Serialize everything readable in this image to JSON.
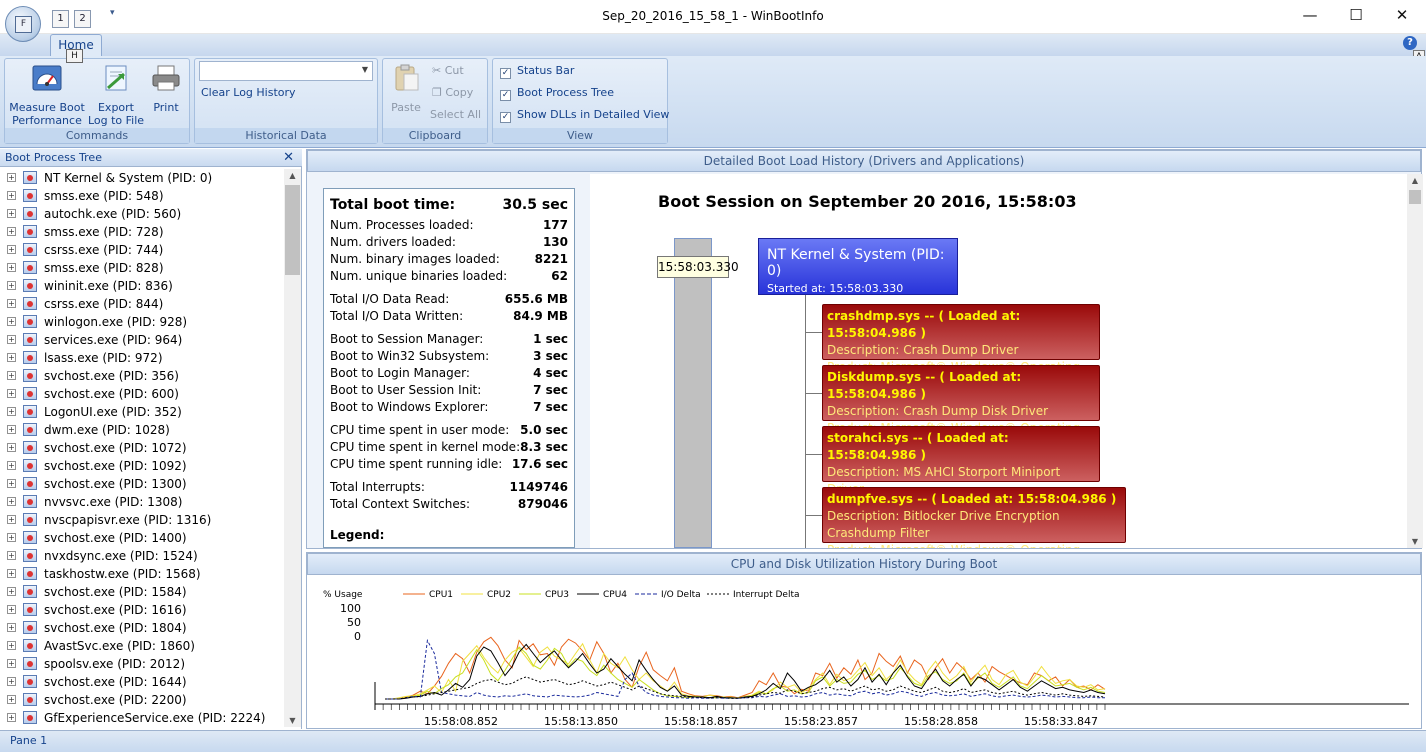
{
  "window": {
    "title": "Sep_20_2016_15_58_1 - WinBootInfo",
    "app_button_tip": "F",
    "qat_tip_1": "1",
    "qat_tip_2": "2",
    "minimize": "—",
    "maximize": "☐",
    "close": "✕"
  },
  "ribbon": {
    "tab_home": "Home",
    "keytip_home": "H",
    "help_icon": "?",
    "keytip_a": "A",
    "commands": {
      "label": "Commands",
      "measure_boot": "Measure Boot Performance",
      "measure_boot_l1": "Measure Boot",
      "measure_boot_l2": "Performance",
      "export_l1": "Export",
      "export_l2": "Log to File",
      "print": "Print"
    },
    "historical": {
      "label": "Historical Data",
      "combo_value": "",
      "clear": "Clear Log History"
    },
    "clipboard": {
      "label": "Clipboard",
      "paste": "Paste",
      "cut": "Cut",
      "copy": "Copy",
      "select_all": "Select All"
    },
    "view": {
      "label": "View",
      "status_bar": "Status Bar",
      "boot_tree": "Boot Process Tree",
      "show_dlls": "Show DLLs in Detailed View"
    }
  },
  "tree_pane": {
    "title": "Boot Process Tree",
    "close": "✕",
    "items": [
      "NT Kernel & System (PID: 0)",
      "smss.exe (PID: 548)",
      "autochk.exe (PID: 560)",
      "smss.exe (PID: 728)",
      "csrss.exe (PID: 744)",
      "smss.exe (PID: 828)",
      "wininit.exe (PID: 836)",
      "csrss.exe (PID: 844)",
      "winlogon.exe (PID: 928)",
      "services.exe (PID: 964)",
      "lsass.exe (PID: 972)",
      "svchost.exe (PID: 356)",
      "svchost.exe (PID: 600)",
      "LogonUI.exe (PID: 352)",
      "dwm.exe (PID: 1028)",
      "svchost.exe (PID: 1072)",
      "svchost.exe (PID: 1092)",
      "svchost.exe (PID: 1300)",
      "nvvsvc.exe (PID: 1308)",
      "nvscpapisvr.exe (PID: 1316)",
      "svchost.exe (PID: 1400)",
      "nvxdsync.exe (PID: 1524)",
      "taskhostw.exe (PID: 1568)",
      "svchost.exe (PID: 1584)",
      "svchost.exe (PID: 1616)",
      "svchost.exe (PID: 1804)",
      "AvastSvc.exe (PID: 1860)",
      "spoolsv.exe (PID: 2012)",
      "svchost.exe (PID: 1644)",
      "svchost.exe (PID: 2200)",
      "GfExperienceService.exe (PID: 2224)"
    ]
  },
  "detail": {
    "header": "Detailed Boot Load History (Drivers and Applications)",
    "stats": {
      "total_label": "Total boot time:",
      "total_value": "30.5 sec",
      "rows1": [
        [
          "Num. Processes loaded:",
          "177"
        ],
        [
          "Num. drivers loaded:",
          "130"
        ],
        [
          "Num. binary images loaded:",
          "8221"
        ],
        [
          "Num. unique binaries loaded:",
          "62"
        ]
      ],
      "rows2": [
        [
          "Total I/O Data Read:",
          "655.6 MB"
        ],
        [
          "Total I/O Data Written:",
          "84.9 MB"
        ]
      ],
      "rows3": [
        [
          "Boot to Session Manager:",
          "1 sec"
        ],
        [
          "Boot to Win32 Subsystem:",
          "3 sec"
        ],
        [
          "Boot to Login Manager:",
          "4 sec"
        ],
        [
          "Boot to User Session Init:",
          "7 sec"
        ],
        [
          "Boot to Windows Explorer:",
          "7 sec"
        ]
      ],
      "rows4": [
        [
          "CPU time spent in user mode:",
          "5.0 sec"
        ],
        [
          "CPU time spent in kernel mode:",
          "8.3 sec"
        ],
        [
          "CPU time spent running idle:",
          "17.6 sec"
        ]
      ],
      "rows5": [
        [
          "Total Interrupts:",
          "1149746"
        ],
        [
          "Total Context Switches:",
          "879046"
        ]
      ],
      "legend": "Legend:"
    },
    "session_title": "Boot Session on September 20 2016, 15:58:03",
    "time_label": "15:58:03.330",
    "nt_title": "NT Kernel & System (PID: 0)",
    "nt_started": "Started at: 15:58:03.330",
    "drivers": [
      {
        "name": "crashdmp.sys -- ( Loaded at: 15:58:04.986 )",
        "desc": "Description: Crash Dump Driver",
        "prod": "Product: Microsoft® Windows® Operating System"
      },
      {
        "name": "Diskdump.sys -- ( Loaded at: 15:58:04.986 )",
        "desc": "Description: Crash Dump Disk Driver",
        "prod": "Product: Microsoft® Windows® Operating System"
      },
      {
        "name": "storahci.sys -- ( Loaded at: 15:58:04.986 )",
        "desc": "Description: MS AHCI Storport Miniport Driver",
        "prod": "Product: Microsoft® Windows® Operating System"
      },
      {
        "name": "dumpfve.sys -- ( Loaded at: 15:58:04.986 )",
        "desc": "Description: Bitlocker Drive Encryption Crashdump Filter",
        "prod": "Product: Microsoft® Windows® Operating System"
      }
    ]
  },
  "cpu_panel": {
    "header": "CPU and Disk Utilization History During Boot"
  },
  "chart_data": {
    "type": "line",
    "ylabel": "% Usage",
    "yticks": [
      "100",
      "50",
      "0"
    ],
    "ylim": [
      0,
      100
    ],
    "xticks": [
      "15:58:08.852",
      "15:58:13.850",
      "15:58:18.857",
      "15:58:23.857",
      "15:58:28.858",
      "15:58:33.847"
    ],
    "legend_position": "top",
    "series": [
      {
        "name": "CPU1",
        "color": "#e8641e",
        "style": "solid",
        "values": [
          0,
          0,
          0,
          3,
          6,
          12,
          8,
          20,
          35,
          55,
          70,
          62,
          40,
          72,
          88,
          95,
          82,
          60,
          48,
          90,
          76,
          85,
          68,
          70,
          52,
          80,
          92,
          86,
          74,
          60,
          88,
          70,
          40,
          55,
          30,
          18,
          50,
          72,
          45,
          36,
          28,
          48,
          12,
          8,
          5,
          4,
          6,
          5,
          3,
          4,
          2,
          6,
          10,
          28,
          22,
          40,
          20,
          18,
          8,
          15,
          12,
          40,
          36,
          55,
          32,
          48,
          38,
          60,
          30,
          40,
          70,
          58,
          50,
          66,
          40,
          60,
          52,
          30,
          48,
          62,
          40,
          56,
          46,
          30,
          40,
          26,
          50,
          42,
          36,
          30,
          25,
          22,
          40,
          36,
          28,
          34,
          20,
          30,
          18,
          20,
          14,
          22,
          15
        ]
      },
      {
        "name": "CPU2",
        "color": "#f0e040",
        "style": "solid",
        "values": [
          0,
          0,
          2,
          4,
          5,
          8,
          14,
          20,
          10,
          30,
          12,
          58,
          70,
          82,
          64,
          50,
          40,
          60,
          72,
          78,
          64,
          50,
          72,
          80,
          66,
          60,
          54,
          70,
          85,
          60,
          40,
          70,
          55,
          48,
          65,
          45,
          30,
          40,
          28,
          20,
          12,
          26,
          8,
          5,
          4,
          3,
          6,
          4,
          2,
          3,
          1,
          4,
          6,
          12,
          8,
          14,
          26,
          18,
          22,
          10,
          16,
          30,
          40,
          22,
          38,
          28,
          32,
          44,
          56,
          36,
          48,
          30,
          40,
          60,
          42,
          30,
          22,
          44,
          58,
          40,
          28,
          36,
          50,
          26,
          40,
          52,
          30,
          22,
          38,
          44,
          26,
          20,
          34,
          50,
          36,
          24,
          28,
          30,
          20,
          18,
          22,
          14,
          16
        ]
      },
      {
        "name": "CPU3",
        "color": "#c8e020",
        "style": "solid",
        "values": [
          0,
          0,
          0,
          2,
          4,
          6,
          12,
          8,
          16,
          22,
          34,
          40,
          58,
          76,
          60,
          38,
          28,
          44,
          62,
          80,
          70,
          52,
          46,
          60,
          78,
          70,
          50,
          62,
          58,
          44,
          36,
          52,
          40,
          30,
          24,
          18,
          30,
          22,
          14,
          8,
          5,
          4,
          3,
          2,
          4,
          3,
          2,
          2,
          3,
          1,
          2,
          3,
          5,
          10,
          8,
          16,
          20,
          12,
          14,
          8,
          10,
          28,
          34,
          20,
          30,
          24,
          26,
          38,
          44,
          30,
          36,
          28,
          32,
          48,
          36,
          24,
          20,
          36,
          42,
          30,
          24,
          28,
          40,
          22,
          32,
          40,
          24,
          18,
          26,
          34,
          20,
          16,
          26,
          36,
          28,
          20,
          22,
          24,
          18,
          14,
          18,
          12,
          10
        ]
      },
      {
        "name": "CPU4",
        "color": "#000000",
        "style": "solid",
        "values": [
          0,
          0,
          0,
          1,
          3,
          4,
          8,
          10,
          6,
          14,
          24,
          18,
          30,
          66,
          80,
          74,
          56,
          36,
          50,
          72,
          84,
          70,
          56,
          66,
          74,
          60,
          48,
          58,
          70,
          54,
          40,
          46,
          62,
          50,
          38,
          28,
          60,
          44,
          30,
          18,
          12,
          20,
          6,
          4,
          3,
          3,
          2,
          4,
          2,
          2,
          1,
          3,
          4,
          8,
          14,
          24,
          16,
          40,
          28,
          12,
          18,
          22,
          30,
          44,
          26,
          34,
          20,
          30,
          48,
          26,
          38,
          22,
          40,
          52,
          34,
          20,
          16,
          32,
          46,
          28,
          20,
          30,
          38,
          20,
          34,
          30,
          22,
          14,
          22,
          30,
          18,
          12,
          20,
          28,
          22,
          16,
          18,
          14,
          12,
          10,
          14,
          10,
          8
        ]
      },
      {
        "name": "I/O Delta",
        "color": "#1a2a9c",
        "style": "dashed",
        "values": [
          0,
          0,
          0,
          2,
          4,
          3,
          90,
          70,
          10,
          8,
          6,
          5,
          4,
          10,
          6,
          4,
          3,
          5,
          4,
          6,
          8,
          5,
          4,
          3,
          6,
          5,
          4,
          3,
          4,
          6,
          10,
          8,
          6,
          4,
          30,
          40,
          20,
          10,
          6,
          4,
          3,
          2,
          2,
          1,
          2,
          1,
          1,
          2,
          1,
          1,
          1,
          2,
          2,
          4,
          3,
          6,
          8,
          4,
          5,
          3,
          4,
          8,
          10,
          6,
          8,
          6,
          5,
          10,
          12,
          8,
          10,
          6,
          8,
          12,
          10,
          6,
          4,
          8,
          10,
          6,
          5,
          6,
          8,
          4,
          6,
          8,
          5,
          3,
          5,
          6,
          4,
          3,
          4,
          6,
          5,
          3,
          4,
          3,
          2,
          2,
          3,
          2,
          2
        ]
      },
      {
        "name": "Interrupt Delta",
        "color": "#000000",
        "style": "dotted",
        "values": [
          0,
          0,
          0,
          2,
          3,
          4,
          6,
          8,
          10,
          12,
          14,
          16,
          18,
          24,
          28,
          30,
          26,
          22,
          24,
          30,
          34,
          30,
          26,
          28,
          30,
          26,
          22,
          24,
          28,
          24,
          20,
          22,
          26,
          22,
          18,
          14,
          20,
          16,
          12,
          8,
          6,
          5,
          4,
          3,
          3,
          2,
          2,
          2,
          2,
          1,
          1,
          2,
          3,
          6,
          8,
          10,
          9,
          14,
          12,
          8,
          10,
          12,
          16,
          18,
          14,
          16,
          12,
          16,
          20,
          14,
          16,
          12,
          14,
          20,
          16,
          12,
          10,
          14,
          18,
          12,
          10,
          12,
          16,
          10,
          12,
          14,
          10,
          8,
          10,
          12,
          8,
          6,
          8,
          10,
          8,
          6,
          8,
          6,
          5,
          4,
          5,
          4,
          3
        ]
      }
    ]
  },
  "status": {
    "pane": "Pane 1"
  }
}
